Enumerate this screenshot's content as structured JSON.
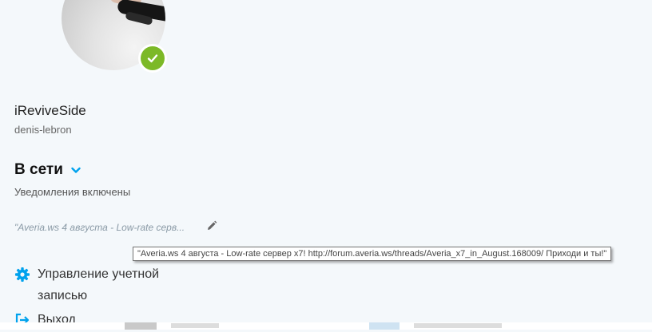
{
  "profile": {
    "display_name": "iReviveSide",
    "username": "denis-lebron",
    "status": "В сети",
    "notifications": "Уведомления включены",
    "mood_truncated": "\"Averia.ws 4 августа - Low-rate серв...",
    "mood_tooltip": "\"Averia.ws 4 августа - Low-rate сервер x7! http://forum.averia.ws/threads/Averia_x7_in_August.168009/ Приходи и ты!\""
  },
  "menu": {
    "manage_account": "Управление учетной записью",
    "logout": "Выход"
  },
  "colors": {
    "accent": "#00a2ed",
    "presence_online": "#7cb927",
    "background": "#f4f8fb"
  },
  "icons": {
    "presence": "check-icon",
    "status_dropdown": "chevron-down-icon",
    "edit_mood": "pencil-icon",
    "manage_account": "gear-icon",
    "logout": "logout-icon"
  }
}
